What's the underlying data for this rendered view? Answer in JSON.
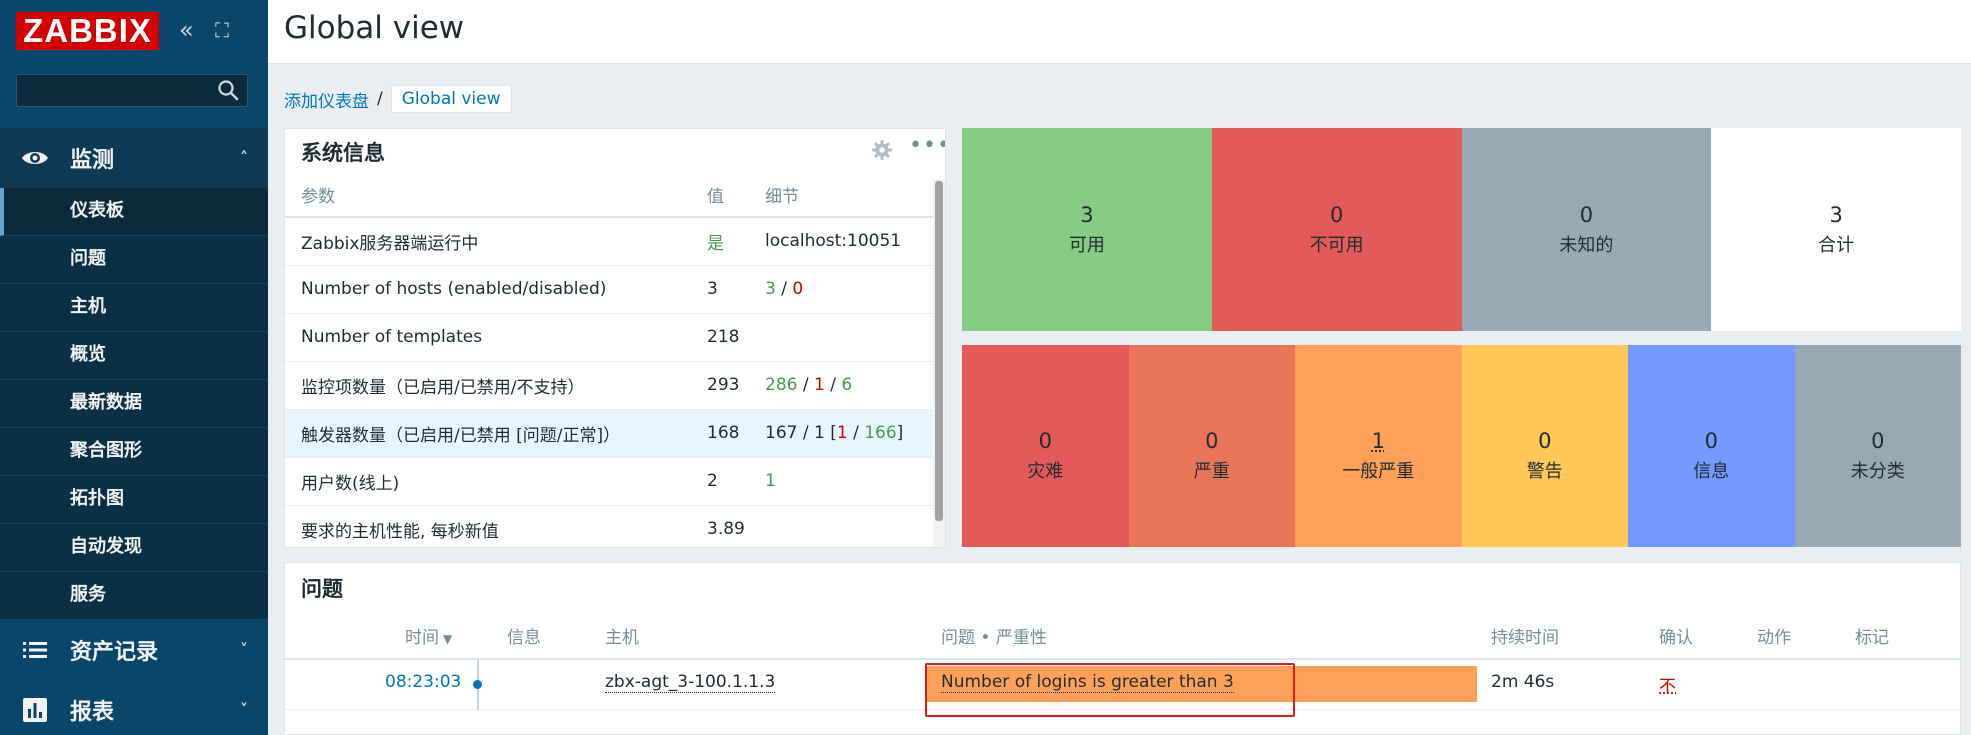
{
  "sidebar": {
    "logo": "ZABBIX",
    "collapse_glyph": "«",
    "kiosk_glyph": "⛶",
    "search": {
      "value": "",
      "placeholder": ""
    },
    "sections": [
      {
        "label": "监测",
        "icon": "eye-icon",
        "expanded": true
      },
      {
        "label": "资产记录",
        "icon": "list-icon",
        "expanded": false
      },
      {
        "label": "报表",
        "icon": "bar-chart-icon",
        "expanded": false
      }
    ],
    "monitoring_items": [
      "仪表板",
      "问题",
      "主机",
      "概览",
      "最新数据",
      "聚合图形",
      "拓扑图",
      "自动发现",
      "服务"
    ],
    "active_item": "仪表板"
  },
  "header": {
    "title": "Global view"
  },
  "breadcrumb": {
    "parent": "添加仪表盘",
    "separator": "/",
    "current": "Global view"
  },
  "system_info": {
    "title": "系统信息",
    "columns": [
      "参数",
      "值",
      "细节"
    ],
    "rows": [
      {
        "param": "Zabbix服务器端运行中",
        "value": "是",
        "detail": "localhost:10051"
      },
      {
        "param": "Number of hosts (enabled/disabled)",
        "value": "3",
        "detail_enabled": "3",
        "detail_sep": " / ",
        "detail_disabled": "0"
      },
      {
        "param": "Number of templates",
        "value": "218",
        "detail": ""
      },
      {
        "param": "监控项数量（已启用/已禁用/不支持）",
        "value": "293",
        "d_enabled": "286",
        "d_sep1": " / ",
        "d_disabled": "1",
        "d_sep2": " / ",
        "d_unsupported": "6"
      },
      {
        "param": "触发器数量（已启用/已禁用 [问题/正常]）",
        "value": "168",
        "d_prefix": "167 / 1 [",
        "d_problem": "1",
        "d_sep": " / ",
        "d_ok": "166",
        "d_suffix": "]"
      },
      {
        "param": "用户数(线上)",
        "value": "2",
        "detail": "1"
      },
      {
        "param": "要求的主机性能, 每秒新值",
        "value": "3.89",
        "detail": ""
      }
    ]
  },
  "host_availability": [
    {
      "count": "3",
      "label": "可用",
      "color": "#86cc85"
    },
    {
      "count": "0",
      "label": "不可用",
      "color": "#e45959"
    },
    {
      "count": "0",
      "label": "未知的",
      "color": "#97aab3"
    },
    {
      "count": "3",
      "label": "合计",
      "color": "#ffffff"
    }
  ],
  "problems_by_severity": [
    {
      "count": "0",
      "label": "灾难",
      "color": "#e45959"
    },
    {
      "count": "0",
      "label": "严重",
      "color": "#e97659"
    },
    {
      "count": "1",
      "label": "一般严重",
      "color": "#ffa059"
    },
    {
      "count": "0",
      "label": "警告",
      "color": "#ffc859"
    },
    {
      "count": "0",
      "label": "信息",
      "color": "#7499ff"
    },
    {
      "count": "0",
      "label": "未分类",
      "color": "#97aab3"
    }
  ],
  "problems": {
    "title": "问题",
    "columns": {
      "time": "时间",
      "time_sort": "▼",
      "info": "信息",
      "host": "主机",
      "problem": "问题 • 严重性",
      "duration": "持续时间",
      "ack": "确认",
      "actions": "动作",
      "tags": "标记"
    },
    "row": {
      "time": "08:23:03",
      "host": "zbx-agt_3-100.1.1.3",
      "problem": "Number of logins is greater than 3",
      "duration": "2m 46s",
      "ack": "不"
    }
  }
}
